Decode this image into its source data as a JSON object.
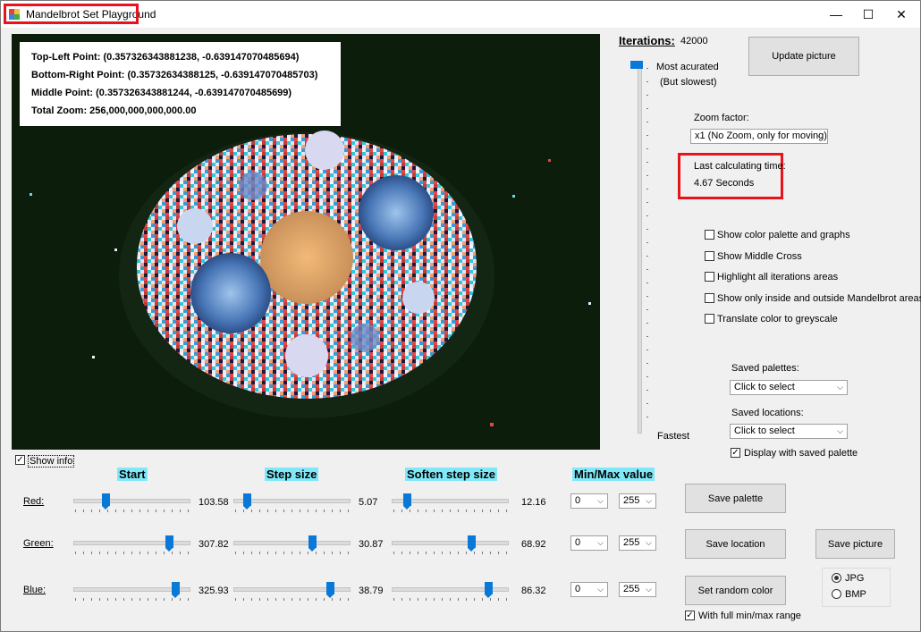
{
  "window": {
    "title": "Mandelbrot Set Playground",
    "minimize": "—",
    "maximize": "☐",
    "close": "✕"
  },
  "info": {
    "top_left": "Top-Left  Point:  (0.357326343881238,  -0.639147070485694)",
    "bottom_right": "Bottom-Right  Point:  (0.35732634388125,  -0.639147070485703)",
    "middle": "Middle  Point:  (0.357326343881244,  -0.639147070485699)",
    "total_zoom": "Total Zoom: 256,000,000,000,000.00"
  },
  "show_info": {
    "label": "Show info",
    "checked": true
  },
  "iterations": {
    "label": "Iterations:",
    "value": "42000",
    "top_caption": "Most acurated",
    "top_sub": "(But slowest)",
    "bottom_caption": "Fastest"
  },
  "update_button": "Update picture",
  "zoom": {
    "label": "Zoom factor:",
    "value": "x1 (No Zoom, only for moving)"
  },
  "calc": {
    "label": "Last calculating time:",
    "value": "4.67 Seconds"
  },
  "options": [
    {
      "label": "Show color palette and graphs",
      "checked": false
    },
    {
      "label": "Show Middle Cross",
      "checked": false
    },
    {
      "label": "Highlight all iterations areas",
      "checked": false
    },
    {
      "label": "Show only inside and outside Mandelbrot areas",
      "checked": false
    },
    {
      "label": "Translate color to greyscale",
      "checked": false
    }
  ],
  "saved_palettes": {
    "label": "Saved palettes:",
    "value": "Click to select"
  },
  "saved_locations": {
    "label": "Saved locations:",
    "value": "Click to select"
  },
  "display_saved_palette": {
    "label": "Display with saved palette",
    "checked": true
  },
  "columns": {
    "start": "Start",
    "step": "Step size",
    "soften": "Soften step size",
    "minmax": "Min/Max value"
  },
  "rows": [
    {
      "name": "Red:",
      "start": "103.58",
      "start_pos": 0.28,
      "step": "5.07",
      "step_pos": 0.12,
      "soften": "12.16",
      "soften_pos": 0.13,
      "min": "0",
      "max": "255"
    },
    {
      "name": "Green:",
      "start": "307.82",
      "start_pos": 0.83,
      "step": "30.87",
      "step_pos": 0.68,
      "soften": "68.92",
      "soften_pos": 0.69,
      "min": "0",
      "max": "255"
    },
    {
      "name": "Blue:",
      "start": "325.93",
      "start_pos": 0.88,
      "step": "38.79",
      "step_pos": 0.84,
      "soften": "86.32",
      "soften_pos": 0.84,
      "min": "0",
      "max": "255"
    }
  ],
  "buttons": {
    "save_palette": "Save  palette",
    "save_location": "Save location",
    "save_picture": "Save picture",
    "random_color": "Set random color"
  },
  "full_range": {
    "label": "With full min/max range",
    "checked": true
  },
  "format": {
    "jpg": "JPG",
    "bmp": "BMP",
    "selected": "JPG"
  },
  "colors": {
    "highlight": "#e8141c",
    "accent": "#0a78d7",
    "header_bg": "#7fe9f9"
  }
}
